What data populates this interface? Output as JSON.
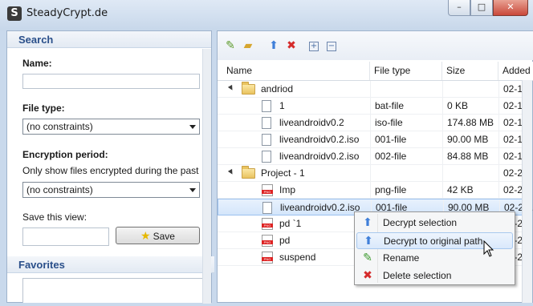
{
  "window": {
    "title": "SteadyCrypt.de",
    "app_icon": "S",
    "minimize": "–",
    "maximize": "□",
    "close": "✕"
  },
  "search": {
    "heading": "Search",
    "name_label": "Name:",
    "name_value": "",
    "filetype_label": "File type:",
    "filetype_value": "(no constraints)",
    "period_label": "Encryption period:",
    "period_hint": "Only show files encrypted during the past",
    "period_value": "(no constraints)",
    "saveview_label": "Save this view:",
    "saveview_value": "",
    "save_button": "Save"
  },
  "favorites": {
    "heading": "Favorites"
  },
  "toolbar": {
    "icons": [
      "add-file-icon",
      "add-folder-icon",
      "decrypt-icon",
      "delete-icon",
      "expand-all-icon",
      "collapse-all-icon"
    ]
  },
  "grid": {
    "columns": [
      "Name",
      "File type",
      "Size",
      "Added"
    ],
    "rows": [
      {
        "name": "andriod",
        "type": "",
        "size": "",
        "added": "02-19-...",
        "kind": "folder",
        "level": 0
      },
      {
        "name": "1",
        "type": "bat-file",
        "size": "0 KB",
        "added": "02-19-...",
        "kind": "file",
        "level": 1
      },
      {
        "name": "liveandroidv0.2",
        "type": "iso-file",
        "size": "174.88 MB",
        "added": "02-19-...",
        "kind": "file",
        "level": 1
      },
      {
        "name": "liveandroidv0.2.iso",
        "type": "001-file",
        "size": "90.00 MB",
        "added": "02-19-...",
        "kind": "file",
        "level": 1
      },
      {
        "name": "liveandroidv0.2.iso",
        "type": "002-file",
        "size": "84.88 MB",
        "added": "02-19-...",
        "kind": "file",
        "level": 1
      },
      {
        "name": "Project - 1",
        "type": "",
        "size": "",
        "added": "02-21-...",
        "kind": "folder",
        "level": 0
      },
      {
        "name": "Imp",
        "type": "png-file",
        "size": "42 KB",
        "added": "02-21-...",
        "kind": "png",
        "level": 1
      },
      {
        "name": "liveandroidv0.2.iso",
        "type": "001-file",
        "size": "90.00 MB",
        "added": "02-21-...",
        "kind": "file",
        "level": 1,
        "selected": true
      },
      {
        "name": "pd `1",
        "type": "",
        "size": "",
        "added": "02-21-...",
        "kind": "png",
        "level": 1
      },
      {
        "name": "pd",
        "type": "",
        "size": "",
        "added": "02-21-...",
        "kind": "png",
        "level": 1
      },
      {
        "name": "suspend",
        "type": "",
        "size": "",
        "added": "02-21-...",
        "kind": "png",
        "level": 1
      }
    ]
  },
  "context_menu": {
    "items": [
      {
        "label": "Decrypt selection",
        "icon": "decrypt-icon"
      },
      {
        "label": "Decrypt to original path",
        "icon": "decrypt-original-icon"
      },
      {
        "label": "Rename",
        "icon": "rename-pencil-icon"
      },
      {
        "label": "Delete selection",
        "icon": "delete-icon"
      }
    ]
  },
  "colors": {
    "accent": "#2a4f8a",
    "selection": "#d4e6fb",
    "delete": "#d52b2b",
    "decrypt": "#3f7fd9"
  }
}
